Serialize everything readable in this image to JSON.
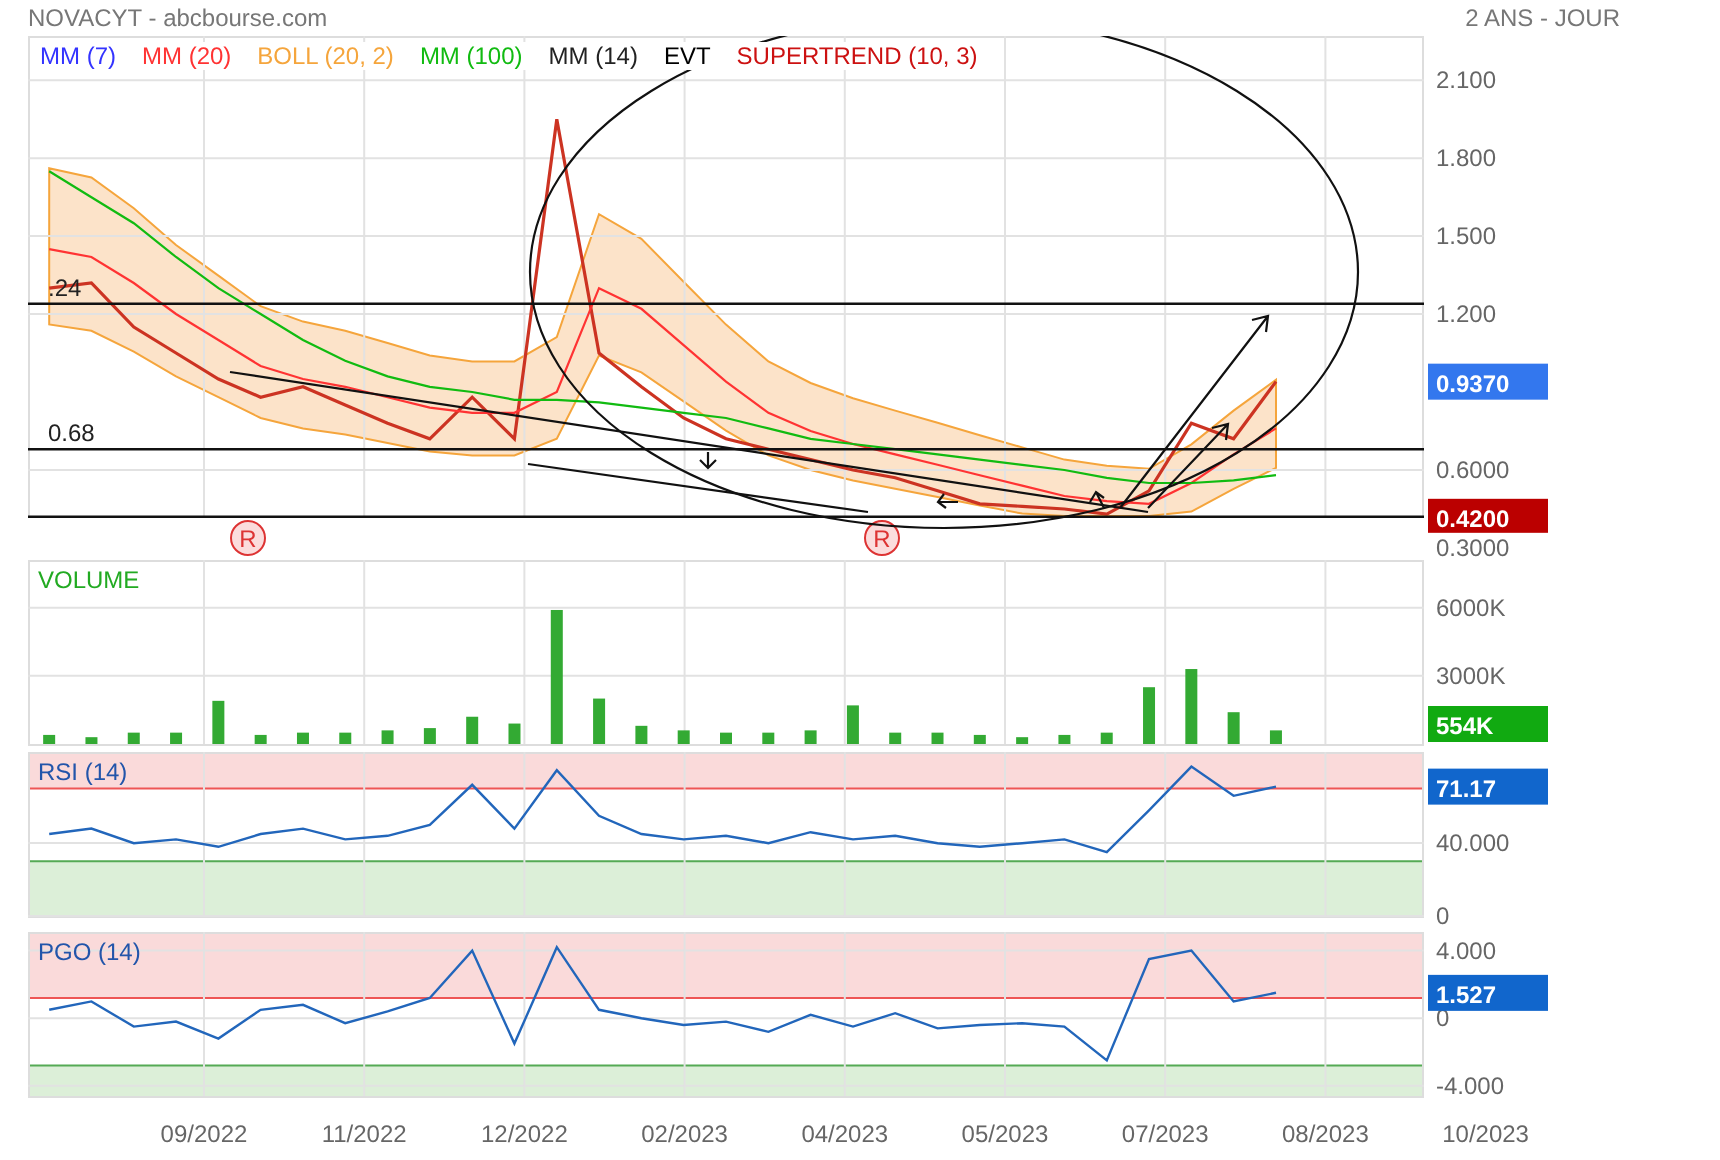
{
  "header": {
    "title": "NOVACYT - abcbourse.com",
    "period": "2 ANS - JOUR"
  },
  "date_axis": [
    "09/2022",
    "11/2022",
    "12/2022",
    "02/2023",
    "04/2023",
    "05/2023",
    "07/2023",
    "08/2023",
    "10/2023"
  ],
  "price_panel": {
    "legend": [
      {
        "label": "MM (7)",
        "color": "#3333ff"
      },
      {
        "label": "MM (20)",
        "color": "#ff3333"
      },
      {
        "label": "BOLL (20, 2)",
        "color": "#f5a53c"
      },
      {
        "label": "MM (100)",
        "color": "#11bb11"
      },
      {
        "label": "MM (14)",
        "color": "#222222"
      },
      {
        "label": "EVT",
        "color": "#000000"
      },
      {
        "label": "SUPERTREND (10, 3)",
        "color": "#cc1111"
      }
    ],
    "last_badge": {
      "text": "0.9370",
      "color": "#3377ee"
    },
    "levels": [
      {
        "label": ".24"
      },
      {
        "label": "0.68"
      },
      {
        "label": "0.4200",
        "color": "#bb0000"
      }
    ],
    "chart_data": {
      "type": "line",
      "grid": true,
      "categories": [
        null,
        null,
        null,
        null,
        null,
        null,
        null,
        null,
        null,
        null,
        null,
        null,
        null,
        null,
        null,
        null,
        null,
        null,
        null,
        null,
        null,
        null,
        null,
        null,
        null,
        null,
        null,
        null,
        null,
        null,
        null,
        null,
        null
      ],
      "ylim": [
        0.3,
        2.27
      ],
      "yticks": [
        {
          "value": 0.3,
          "label": "0.3000"
        },
        {
          "value": 0.6,
          "label": "0.6000"
        },
        {
          "value": 1.2,
          "label": "1.200"
        },
        {
          "value": 1.5,
          "label": "1.500"
        },
        {
          "value": 1.8,
          "label": "1.800"
        },
        {
          "value": 2.1,
          "label": "2.100"
        }
      ],
      "series": [
        {
          "color": "#cc3322",
          "values": [
            1.3,
            1.32,
            1.15,
            1.05,
            0.95,
            0.88,
            0.92,
            0.85,
            0.78,
            0.72,
            0.88,
            0.72,
            1.95,
            1.05,
            0.92,
            0.8,
            0.72,
            0.68,
            0.64,
            0.6,
            0.57,
            0.52,
            0.47,
            0.46,
            0.45,
            0.43,
            0.52,
            0.78,
            0.72,
            0.94,
            null,
            null,
            null
          ]
        },
        {
          "color": "#ff3333",
          "values": [
            1.45,
            1.42,
            1.32,
            1.2,
            1.1,
            1.0,
            0.95,
            0.92,
            0.88,
            0.84,
            0.82,
            0.82,
            0.9,
            1.3,
            1.22,
            1.08,
            0.94,
            0.82,
            0.75,
            0.7,
            0.66,
            0.62,
            0.58,
            0.54,
            0.5,
            0.48,
            0.47,
            0.55,
            0.66,
            0.76,
            null,
            null,
            null
          ]
        },
        {
          "color": "#11bb11",
          "values": [
            1.75,
            1.65,
            1.55,
            1.42,
            1.3,
            1.2,
            1.1,
            1.02,
            0.96,
            0.92,
            0.9,
            0.87,
            0.87,
            0.86,
            0.84,
            0.82,
            0.8,
            0.76,
            0.72,
            0.7,
            0.68,
            0.66,
            0.64,
            0.62,
            0.6,
            0.57,
            0.55,
            0.55,
            0.56,
            0.58,
            null,
            null,
            null
          ]
        }
      ],
      "annotations": [
        "R",
        "R"
      ]
    }
  },
  "volume_panel": {
    "last_badge": {
      "text": "554K",
      "color": "#11aa11"
    },
    "chart_data": {
      "type": "bar",
      "title": "VOLUME",
      "grid": true,
      "categories": [
        null,
        null,
        null,
        null,
        null,
        null,
        null,
        null,
        null,
        null,
        null,
        null,
        null,
        null,
        null,
        null,
        null,
        null,
        null,
        null,
        null,
        null,
        null,
        null,
        null,
        null,
        null,
        null,
        null,
        null,
        null,
        null,
        null
      ],
      "ylim": [
        0,
        8100
      ],
      "yticks": [
        {
          "value": 3000,
          "label": "3000K"
        },
        {
          "value": 6000,
          "label": "6000K"
        }
      ],
      "series": [
        {
          "color": "#33aa33",
          "values": [
            400,
            300,
            500,
            500,
            1900,
            400,
            500,
            500,
            600,
            700,
            1200,
            900,
            5900,
            2000,
            800,
            600,
            500,
            500,
            600,
            1700,
            500,
            500,
            400,
            300,
            400,
            500,
            2500,
            3300,
            1400,
            600,
            null,
            null,
            null
          ]
        }
      ]
    }
  },
  "rsi_panel": {
    "last_badge": {
      "text": "71.17",
      "color": "#1166cc"
    },
    "chart_data": {
      "type": "line",
      "title": "RSI (14)",
      "grid": true,
      "categories": [
        null,
        null,
        null,
        null,
        null,
        null,
        null,
        null,
        null,
        null,
        null,
        null,
        null,
        null,
        null,
        null,
        null,
        null,
        null,
        null,
        null,
        null,
        null,
        null,
        null,
        null,
        null,
        null,
        null,
        null,
        null,
        null,
        null
      ],
      "ylim": [
        0,
        90
      ],
      "yticks": [
        {
          "value": 0,
          "label": "0"
        },
        {
          "value": 40,
          "label": "40.000"
        }
      ],
      "series": [
        {
          "color": "#2266bb",
          "values": [
            45,
            48,
            40,
            42,
            38,
            45,
            48,
            42,
            44,
            50,
            72,
            48,
            80,
            55,
            45,
            42,
            44,
            40,
            46,
            42,
            44,
            40,
            38,
            40,
            42,
            35,
            58,
            82,
            66,
            71,
            null,
            null,
            null
          ]
        }
      ]
    }
  },
  "pgo_panel": {
    "last_badge": {
      "text": "1.527",
      "color": "#1166cc"
    },
    "chart_data": {
      "type": "line",
      "title": "PGO (14)",
      "grid": true,
      "categories": [
        null,
        null,
        null,
        null,
        null,
        null,
        null,
        null,
        null,
        null,
        null,
        null,
        null,
        null,
        null,
        null,
        null,
        null,
        null,
        null,
        null,
        null,
        null,
        null,
        null,
        null,
        null,
        null,
        null,
        null,
        null,
        null,
        null
      ],
      "ylim": [
        -4.6,
        5.1
      ],
      "yticks": [
        {
          "value": -4,
          "label": "-4.000"
        },
        {
          "value": 0,
          "label": "0"
        },
        {
          "value": 4,
          "label": "4.000"
        }
      ],
      "series": [
        {
          "color": "#2266bb",
          "values": [
            0.5,
            1.0,
            -0.5,
            -0.2,
            -1.2,
            0.5,
            0.8,
            -0.3,
            0.4,
            1.2,
            4.0,
            -1.5,
            4.2,
            0.5,
            0.0,
            -0.4,
            -0.2,
            -0.8,
            0.2,
            -0.5,
            0.3,
            -0.6,
            -0.4,
            -0.3,
            -0.5,
            -2.5,
            3.5,
            4.0,
            1.0,
            1.5,
            null,
            null,
            null
          ]
        }
      ]
    }
  }
}
